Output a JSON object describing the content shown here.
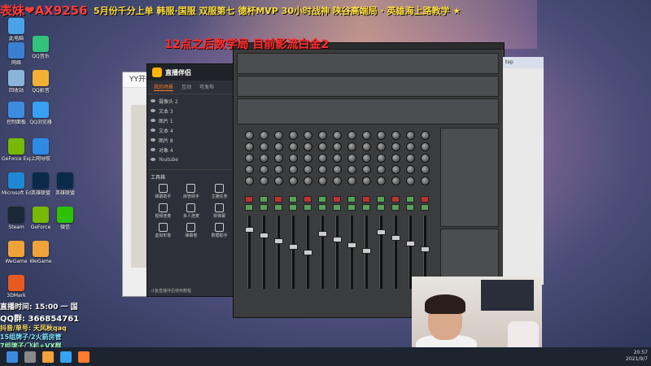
{
  "marquee": {
    "left_text": "表妹❤AX9256",
    "middle_text": "5月份千分上单 韩服·国服 双服第七 德杯MVP 30小时战神 陕谷高端局 · 英雄海上路教学 ★"
  },
  "overlay_title": "12点之后数学局 目前影流白金2",
  "desktop_icons": [
    {
      "label": "此电脑",
      "color": "#4aa3e8"
    },
    {
      "label": "网络",
      "color": "#3b7fd3"
    },
    {
      "label": "回收站",
      "color": "#8ab4d8"
    },
    {
      "label": "控制面板",
      "color": "#3c8de0"
    },
    {
      "label": "GeForce Experience",
      "color": "#76b900"
    },
    {
      "label": "Microsoft Edge",
      "color": "#1f88d6"
    },
    {
      "label": "Steam",
      "color": "#1b2838"
    },
    {
      "label": "WeGame",
      "color": "#f2a23a"
    },
    {
      "label": "3DMark",
      "color": "#ea5a1f"
    },
    {
      "label": "QQ音乐",
      "color": "#31c27c"
    },
    {
      "label": "QQ影音",
      "color": "#f2b134"
    },
    {
      "label": "QQ浏览器",
      "color": "#38a1f3"
    },
    {
      "label": "上网导航",
      "color": "#2f8ae6"
    },
    {
      "label": "英雄联盟",
      "color": "#0a2a4a"
    },
    {
      "label": "GeForce",
      "color": "#76b900"
    },
    {
      "label": "WeGame",
      "color": "#f2a23a"
    },
    {
      "label": "英雄联盟",
      "color": "#0a2a4a"
    },
    {
      "label": "微信",
      "color": "#2dc100"
    }
  ],
  "background_window": {
    "title": "YY开播"
  },
  "zhibo_app": {
    "title": "直播伴侣",
    "tabs": [
      "我的场景",
      "互动",
      "可发布"
    ],
    "sources": [
      "摄像头 2",
      "文本 3",
      "图片 1",
      "文本 4",
      "图片 8",
      "对象 4",
      "Youtube"
    ],
    "tools_header": "工具箱",
    "tools": [
      "弹幕助手",
      "房管助手",
      "主播任务",
      "视频连麦",
      "多人连麦",
      "拼弹幕",
      "虚拟形象",
      "弹幕卷",
      "数据助手",
      "",
      "",
      ""
    ],
    "footer": "斗鱼直播伴侣使用教程"
  },
  "side_panel": {
    "title": "top"
  },
  "stream_info": {
    "time": "直播时间: 15:00 一 国",
    "qq_group": "QQ群: 366854761",
    "douyin": "抖音/单号: 天风秋qaq",
    "line3": "15组牌子/2火箭房管",
    "line4": "7组牌子/飞机+VX群"
  },
  "taskbar": {
    "time": "20:57",
    "date": "2021/9/7"
  }
}
